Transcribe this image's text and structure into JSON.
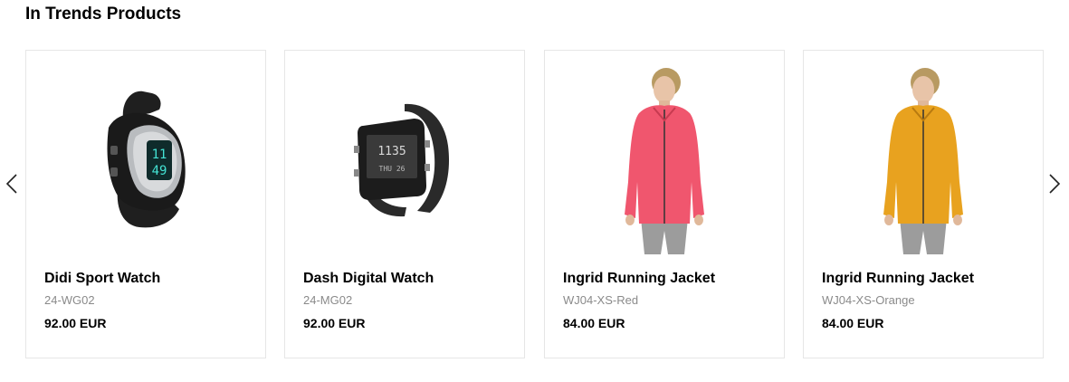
{
  "section": {
    "title": "In Trends Products"
  },
  "carousel": {
    "prev_icon": "chevron-left-icon",
    "next_icon": "chevron-right-icon"
  },
  "products": [
    {
      "name": "Didi Sport Watch",
      "sku": "24-WG02",
      "price": "92.00 EUR",
      "image": "sport-watch-image"
    },
    {
      "name": "Dash Digital Watch",
      "sku": "24-MG02",
      "price": "92.00 EUR",
      "image": "digital-watch-image"
    },
    {
      "name": "Ingrid Running Jacket",
      "sku": "WJ04-XS-Red",
      "price": "84.00 EUR",
      "image": "running-jacket-image",
      "color": "#f0566e"
    },
    {
      "name": "Ingrid Running Jacket",
      "sku": "WJ04-XS-Orange",
      "price": "84.00 EUR",
      "image": "running-jacket-image",
      "color": "#e8a21f"
    }
  ]
}
